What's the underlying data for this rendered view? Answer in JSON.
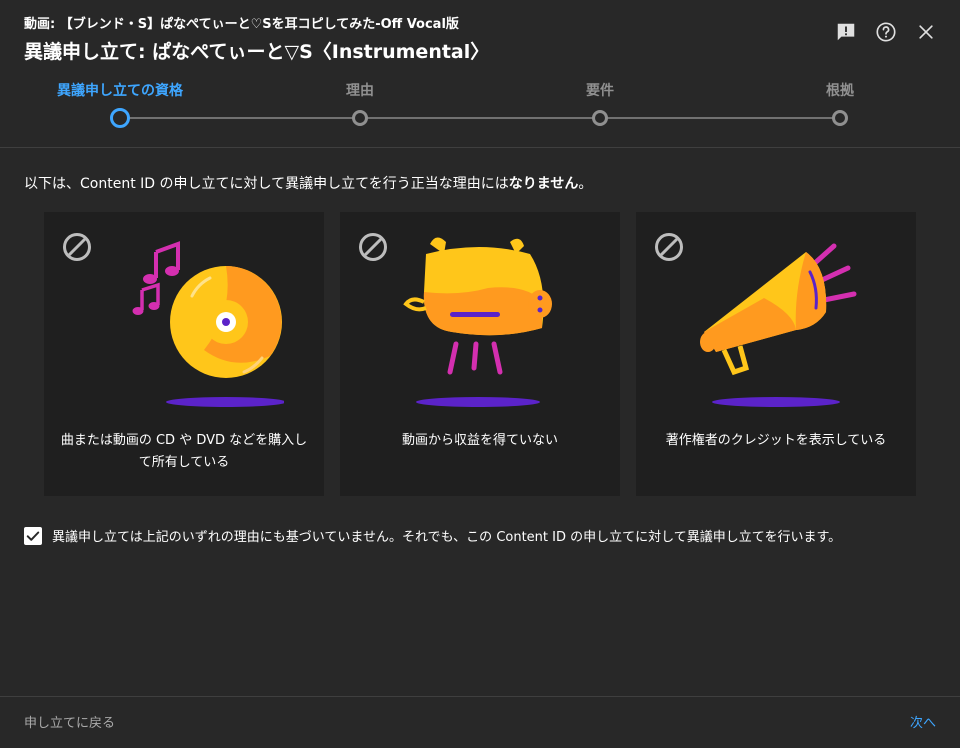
{
  "header": {
    "video_label": "動画: 【ブレンド・S】ぱなぺてぃーと♡Sを耳コピしてみた-Off Vocal版",
    "title": "異議申し立て: ぱなぺてぃーと▽S〈Instrumental〉",
    "icons": [
      "feedback-icon",
      "help-icon",
      "close-icon"
    ]
  },
  "stepper": {
    "steps": [
      {
        "label": "異議申し立ての資格",
        "active": true
      },
      {
        "label": "理由",
        "active": false
      },
      {
        "label": "要件",
        "active": false
      },
      {
        "label": "根拠",
        "active": false
      }
    ]
  },
  "body": {
    "intro_prefix": "以下は、Content ID の申し立てに対して異議申し立てを行う正当な理由には",
    "intro_bold": "なりません",
    "intro_suffix": "。",
    "cards": [
      {
        "text": "曲または動画の CD や DVD などを購入して所有している",
        "icon": "music-disc-icon"
      },
      {
        "text": "動画から収益を得ていない",
        "icon": "piggy-bank-icon"
      },
      {
        "text": "著作権者のクレジットを表示している",
        "icon": "megaphone-icon"
      }
    ],
    "checkbox_label": "異議申し立ては上記のいずれの理由にも基づいていません。それでも、この Content ID の申し立てに対して異議申し立てを行います。",
    "checkbox_checked": true
  },
  "footer": {
    "back_label": "申し立てに戻る",
    "next_label": "次へ"
  },
  "colors": {
    "accent": "#3ea6ff",
    "background": "#282828",
    "card": "#1f1f1f",
    "yellow": "#ffc61a",
    "orange": "#ff9a1f",
    "magenta": "#d42fb0",
    "purple": "#5b23c9"
  }
}
